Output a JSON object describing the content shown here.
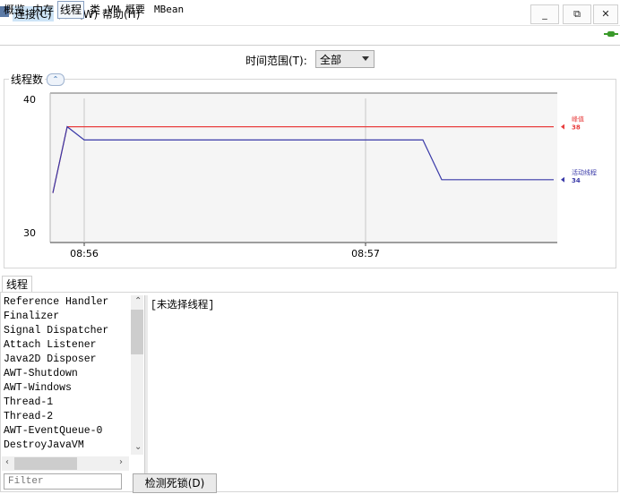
{
  "menu": {
    "connect": "连接(C)",
    "window": "窗口(W)",
    "help": "帮助(H)"
  },
  "window_controls": {
    "minimize": "_",
    "restore": "⧉",
    "close": "✕"
  },
  "tabs": [
    "概览",
    "内存",
    "线程",
    "类",
    "VM 概要",
    "MBean"
  ],
  "selected_tab": "线程",
  "time_range": {
    "label": "时间范围(T):",
    "value": "全部"
  },
  "chart_panel": {
    "title": "线程数"
  },
  "chart_data": {
    "type": "line",
    "ylim": [
      30,
      40
    ],
    "y_ticks": [
      "40",
      "30"
    ],
    "x_ticks": [
      "08:56",
      "08:57"
    ],
    "series": [
      {
        "name": "峰值",
        "value_label": "38",
        "color": "#e83e3e",
        "points": [
          [
            0,
            33
          ],
          [
            1,
            38
          ],
          [
            2,
            38
          ],
          [
            3,
            38
          ],
          [
            4,
            38
          ],
          [
            5,
            38
          ],
          [
            6,
            38
          ],
          [
            7,
            38
          ]
        ]
      },
      {
        "name": "活动线程",
        "value_label": "34",
        "color": "#3a3aa8",
        "points": [
          [
            0,
            33
          ],
          [
            1,
            38
          ],
          [
            2,
            37
          ],
          [
            3,
            37
          ],
          [
            4,
            37
          ],
          [
            5,
            37
          ],
          [
            6,
            34
          ],
          [
            7,
            34
          ]
        ]
      }
    ]
  },
  "threads_tab": "线程",
  "thread_list": [
    "Reference Handler",
    "Finalizer",
    "Signal Dispatcher",
    "Attach Listener",
    "Java2D Disposer",
    "AWT-Shutdown",
    "AWT-Windows",
    "Thread-1",
    "Thread-2",
    "AWT-EventQueue-0",
    "DestroyJavaVM"
  ],
  "detail_text": "[未选择线程]",
  "filter_placeholder": "Filter",
  "detect_deadlock_label": "检测死锁(D)"
}
